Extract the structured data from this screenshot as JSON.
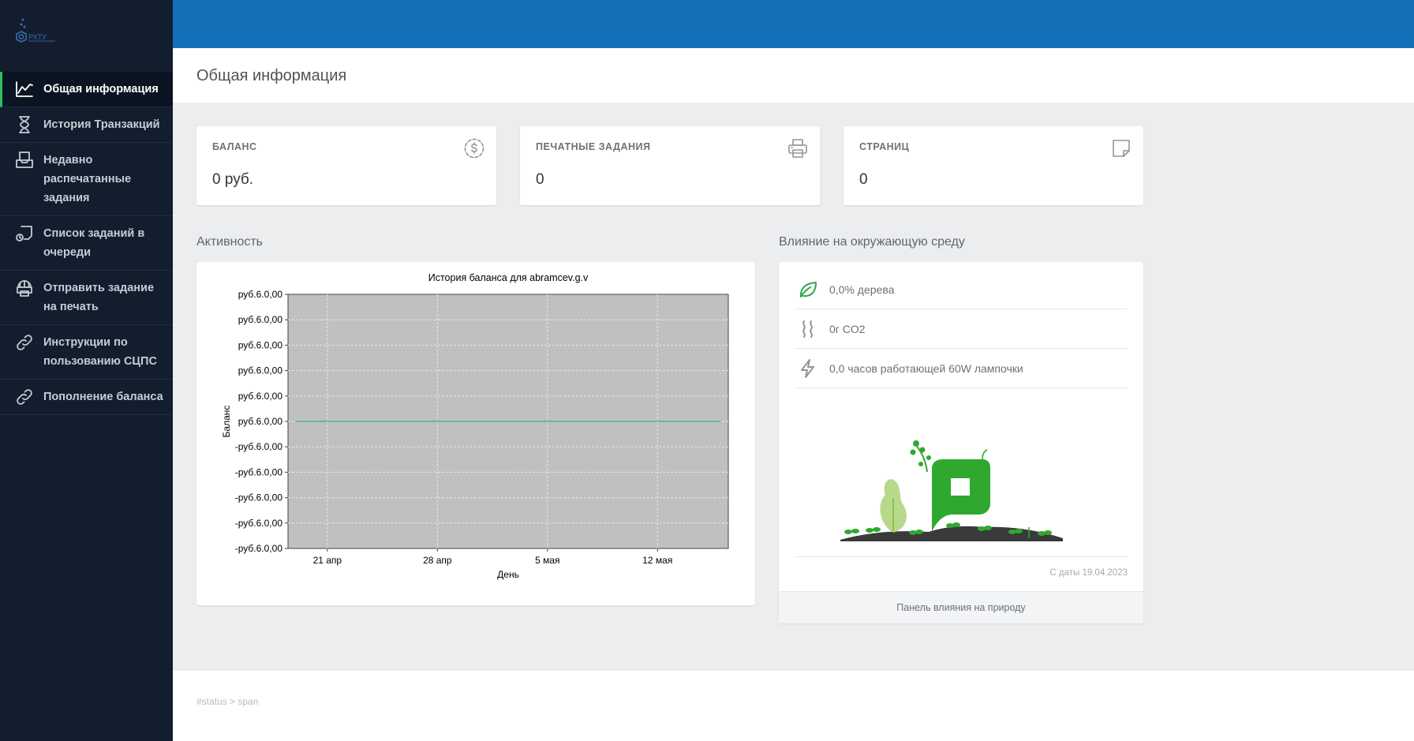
{
  "app": {
    "logo_text": "РХТУ"
  },
  "sidebar": {
    "items": [
      {
        "label": "Общая информация",
        "icon": "chart-line-icon",
        "active": true
      },
      {
        "label": "История Транзакций",
        "icon": "hourglass-icon",
        "active": false
      },
      {
        "label": "Недавно распечатанные задания",
        "icon": "inbox-icon",
        "active": false
      },
      {
        "label": "Список заданий в очереди",
        "icon": "queue-icon",
        "active": false
      },
      {
        "label": "Отправить задание на печать",
        "icon": "web-print-icon",
        "active": false
      },
      {
        "label": "Инструкции по пользованию СЦПС",
        "icon": "link-icon",
        "active": false
      },
      {
        "label": "Пополнение баланса",
        "icon": "link-icon",
        "active": false
      }
    ]
  },
  "header": {
    "title": "Общая информация"
  },
  "stats": {
    "balance": {
      "label": "БАЛАНС",
      "value": "0 руб.",
      "icon": "dollar-circle-icon"
    },
    "print_jobs": {
      "label": "ПЕЧАТНЫЕ ЗАДАНИЯ",
      "value": "0",
      "icon": "printer-icon"
    },
    "pages": {
      "label": "СТРАНИЦ",
      "value": "0",
      "icon": "page-icon"
    }
  },
  "activity": {
    "title": "Активность"
  },
  "environment": {
    "title": "Влияние на окружающую среду",
    "rows": [
      {
        "text": "0,0% дерева",
        "icon": "leaf-icon"
      },
      {
        "text": "0г CO2",
        "icon": "co2-icon"
      },
      {
        "text": "0,0 часов работающей 60W лампочки",
        "icon": "bolt-icon"
      }
    ],
    "since": "С даты 19.04.2023",
    "footer_link": "Панель влияния на природу"
  },
  "status": {
    "text": "#status > span"
  },
  "chart_data": {
    "type": "line",
    "title": "История баланса для abramcev.g.v",
    "xlabel": "День",
    "ylabel": "Баланс",
    "x_tick_labels": [
      "21 апр",
      "28 апр",
      "5 мая",
      "12 мая"
    ],
    "y_tick_labels": [
      "руб.6.0,00",
      "руб.6.0,00",
      "руб.6.0,00",
      "руб.6.0,00",
      "руб.6.0,00",
      "руб.6.0,00",
      "-руб.6.0,00",
      "-руб.6.0,00",
      "-руб.6.0,00",
      "-руб.6.0,00",
      "-руб.6.0,00"
    ],
    "ylim": [
      -5,
      5
    ],
    "grid": true,
    "colors": {
      "plot_bg": "#c0c0c0",
      "line": "#3cb371"
    },
    "series": [
      {
        "x": [
          "19 апр",
          "16 мая"
        ],
        "values": [
          0,
          0
        ]
      }
    ]
  }
}
